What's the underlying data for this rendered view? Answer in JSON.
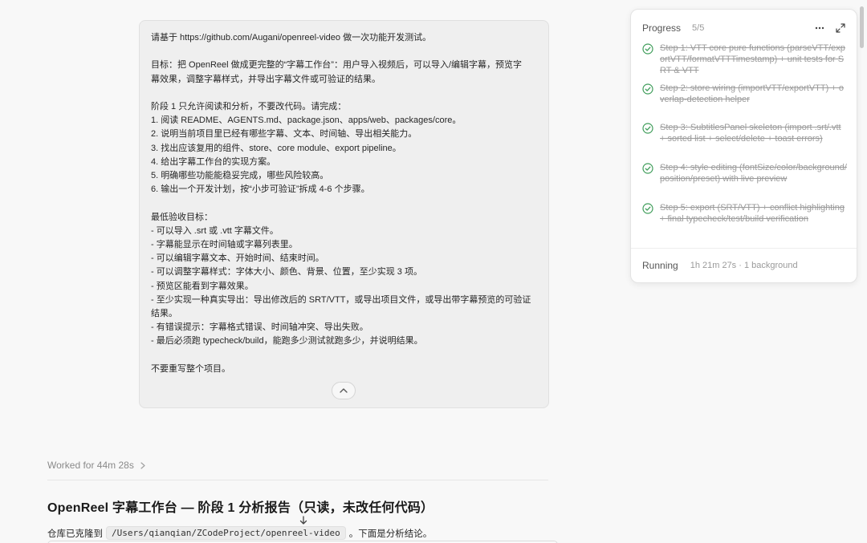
{
  "user_message": {
    "lines": [
      "请基于 https://github.com/Augani/openreel-video 做一次功能开发测试。",
      "",
      "目标：把 OpenReel 做成更完整的“字幕工作台”：用户导入视频后，可以导入/编辑字幕，预览字",
      "幕效果，调整字幕样式，并导出字幕文件或可验证的结果。",
      "",
      "阶段 1 只允许阅读和分析，不要改代码。请完成：",
      "1. 阅读 README、AGENTS.md、package.json、apps/web、packages/core。",
      "2. 说明当前项目里已经有哪些字幕、文本、时间轴、导出相关能力。",
      "3. 找出应该复用的组件、store、core module、export pipeline。",
      "4. 给出字幕工作台的实现方案。",
      "5. 明确哪些功能能稳妥完成，哪些风险较高。",
      "6. 输出一个开发计划，按“小步可验证”拆成 4-6 个步骤。",
      "",
      "最低验收目标：",
      "- 可以导入 .srt 或 .vtt 字幕文件。",
      "- 字幕能显示在时间轴或字幕列表里。",
      "- 可以编辑字幕文本、开始时间、结束时间。",
      "- 可以调整字幕样式：字体大小、颜色、背景、位置，至少实现 3 项。",
      "- 预览区能看到字幕效果。",
      "- 至少实现一种真实导出：导出修改后的 SRT/VTT，或导出项目文件，或导出带字幕预览的可验证",
      "结果。",
      "- 有错误提示：字幕格式错误、时间轴冲突、导出失败。",
      "- 最后必须跑 typecheck/build，能跑多少测试就跑多少，并说明结果。",
      "",
      "不要重写整个项目。"
    ]
  },
  "worked": {
    "label": "Worked for 44m 28s"
  },
  "report": {
    "title": "OpenReel 字幕工作台 — 阶段 1 分析报告（只读，未改任何代码）",
    "intro_before": "仓库已克隆到",
    "path": "/Users/qianqian/ZCodeProject/openreel-video",
    "intro_after": "。下面是分析结论。"
  },
  "progress": {
    "title": "Progress",
    "count": "5/5",
    "steps": [
      {
        "text": "Step 1: VTT core pure functions (parseVTT/exportVTT/formatVTTTimestamp) + unit tests for SRT & VTT"
      },
      {
        "text": "Step 2: store wiring (importVTT/exportVTT) + overlap-detection helper"
      },
      {
        "text": "Step 3: SubtitlesPanel skeleton (import .srt/.vtt + sorted list + select/delete + toast errors)"
      },
      {
        "text": "Step 4: style editing (fontSize/color/background/position/preset) with live preview"
      },
      {
        "text": "Step 5: export (SRT/VTT) + conflict highlighting + final typecheck/test/build verification"
      }
    ],
    "status": "Running",
    "time": "1h 21m 27s · 1 background"
  },
  "colors": {
    "check": "#3f9d5a",
    "text": "#262626",
    "muted": "#9b9b9b"
  }
}
